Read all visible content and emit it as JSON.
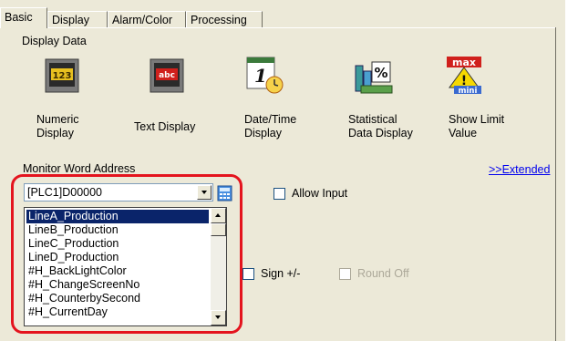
{
  "tabs": [
    {
      "label": "Basic",
      "active": true
    },
    {
      "label": "Display",
      "active": false
    },
    {
      "label": "Alarm/Color",
      "active": false
    },
    {
      "label": "Processing",
      "active": false
    }
  ],
  "display_data": {
    "label": "Display Data",
    "items": [
      {
        "line1": "Numeric",
        "line2": "Display",
        "icon": "numeric-display-icon",
        "glyph": "123"
      },
      {
        "line1": "Text Display",
        "line2": "",
        "icon": "text-display-icon",
        "glyph": "abc"
      },
      {
        "line1": "Date/Time",
        "line2": "Display",
        "icon": "date-time-display-icon",
        "glyph": "1"
      },
      {
        "line1": "Statistical",
        "line2": "Data Display",
        "icon": "statistical-data-display-icon",
        "glyph": "%"
      },
      {
        "line1": "Show Limit",
        "line2": "Value",
        "icon": "show-limit-value-icon",
        "glyph_top": "max",
        "glyph_bottom": "mini"
      }
    ]
  },
  "monitor": {
    "label": "Monitor Word Address",
    "extended_link": ">>Extended",
    "address_value": "[PLC1]D00000",
    "allow_input": {
      "label": "Allow Input",
      "checked": false
    },
    "sign": {
      "label": "Sign +/-",
      "checked": false
    },
    "round_off": {
      "label": "Round Off",
      "checked": false,
      "enabled": false
    }
  },
  "dropdown": {
    "items": [
      "LineA_Production",
      "LineB_Production",
      "LineC_Production",
      "LineD_Production",
      "#H_BackLightColor",
      "#H_ChangeScreenNo",
      "#H_CounterbySecond",
      "#H_CurrentDay"
    ],
    "selected_index": 0
  },
  "colors": {
    "highlight": "#e4141e",
    "selection": "#0a246a",
    "link": "#0000ee"
  }
}
